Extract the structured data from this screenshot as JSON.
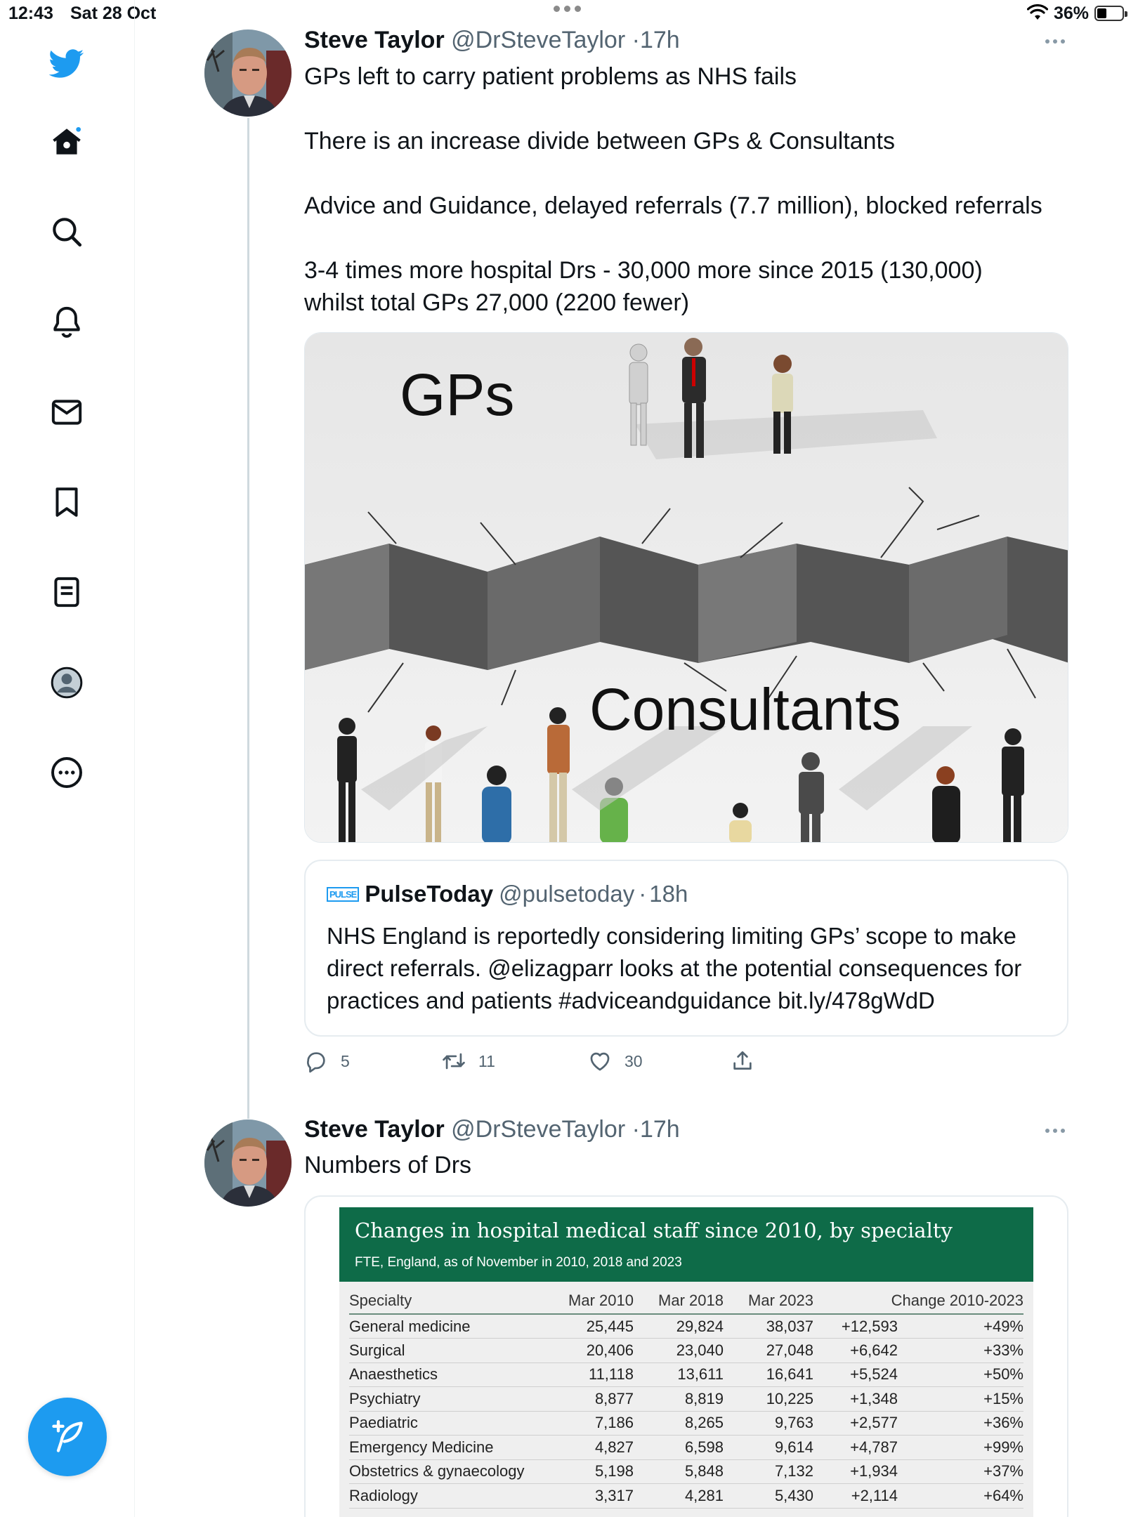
{
  "status_bar": {
    "time": "12:43",
    "date": "Sat 28 Oct",
    "battery": "36%",
    "battery_level": 0.36
  },
  "sidebar": {
    "icons": [
      "twitter-bird-icon",
      "home-icon",
      "search-icon",
      "notifications-icon",
      "messages-icon",
      "bookmarks-icon",
      "lists-icon",
      "profile-icon",
      "more-icon"
    ],
    "compose_icon": "compose-icon"
  },
  "tweet1": {
    "name": "Steve Taylor",
    "handle": "@DrSteveTaylor",
    "time": "17h",
    "lines": [
      "GPs left to carry patient problems as NHS fails",
      "There is an increase divide between GPs & Consultants",
      "Advice and Guidance, delayed referrals (7.7 million), blocked referrals",
      "3-4 times more hospital Drs - 30,000 more since 2015 (130,000) whilst total GPs 27,000 (2200 fewer)"
    ],
    "image": {
      "top_label": "GPs",
      "bottom_label": "Consultants"
    },
    "quote": {
      "logo_text": "PULSE",
      "name": "PulseToday",
      "handle": "@pulsetoday",
      "time": "18h",
      "text": "NHS England is reportedly considering limiting GPs’ scope to make direct referrals. @elizagparr looks at the potential consequences for practices and patients #adviceandguidance bit.ly/478gWdD"
    },
    "actions": {
      "replies": "5",
      "retweets": "11",
      "likes": "30"
    }
  },
  "tweet2": {
    "name": "Steve Taylor",
    "handle": "@DrSteveTaylor",
    "time": "17h",
    "text": "Numbers of Drs",
    "table": {
      "title": "Changes in hospital medical staff since 2010, by specialty",
      "subtitle": "FTE, England, as of November in 2010, 2018 and 2023",
      "columns": [
        "Specialty",
        "Mar 2010",
        "Mar 2018",
        "Mar 2023",
        "Change 2010-2023",
        ""
      ],
      "rows": [
        [
          "General medicine",
          "25,445",
          "29,824",
          "38,037",
          "+12,593",
          "+49%"
        ],
        [
          "Surgical",
          "20,406",
          "23,040",
          "27,048",
          "+6,642",
          "+33%"
        ],
        [
          "Anaesthetics",
          "11,118",
          "13,611",
          "16,641",
          "+5,524",
          "+50%"
        ],
        [
          "Psychiatry",
          "8,877",
          "8,819",
          "10,225",
          "+1,348",
          "+15%"
        ],
        [
          "Paediatric",
          "7,186",
          "8,265",
          "9,763",
          "+2,577",
          "+36%"
        ],
        [
          "Emergency Medicine",
          "4,827",
          "6,598",
          "9,614",
          "+4,787",
          "+99%"
        ],
        [
          "Obstetrics & gynaecology",
          "5,198",
          "5,848",
          "7,132",
          "+1,934",
          "+37%"
        ],
        [
          "Radiology",
          "3,317",
          "4,281",
          "5,430",
          "+2,114",
          "+64%"
        ]
      ]
    }
  }
}
